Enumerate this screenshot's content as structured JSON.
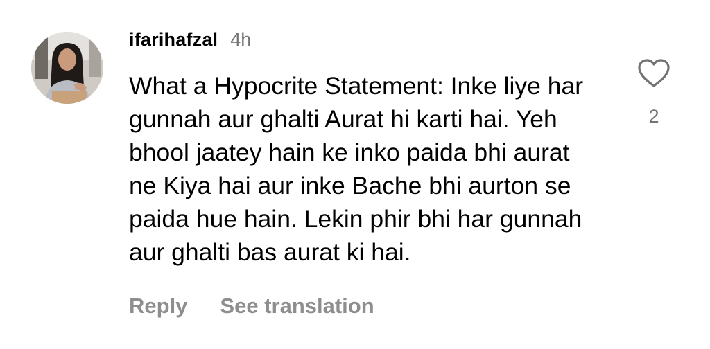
{
  "comment": {
    "avatar_icon": "profile-photo",
    "username": "ifarihafzal",
    "time": "4h",
    "text": "What a Hypocrite Statement: Inke liye har gunnah aur ghalti Aurat hi karti hai. Yeh bhool jaatey hain ke inko paida bhi aurat ne Kiya hai aur inke Bache bhi aurton se paida hue hain. Lekin phir bhi har gunnah aur ghalti bas aurat ki hai.",
    "actions": {
      "reply": "Reply",
      "see_translation": "See translation"
    },
    "like": {
      "icon": "heart-outline-icon",
      "count": "2"
    }
  },
  "colors": {
    "text": "#000000",
    "secondary_text": "#737373",
    "action_text": "#8e8e8e",
    "background": "#ffffff"
  }
}
